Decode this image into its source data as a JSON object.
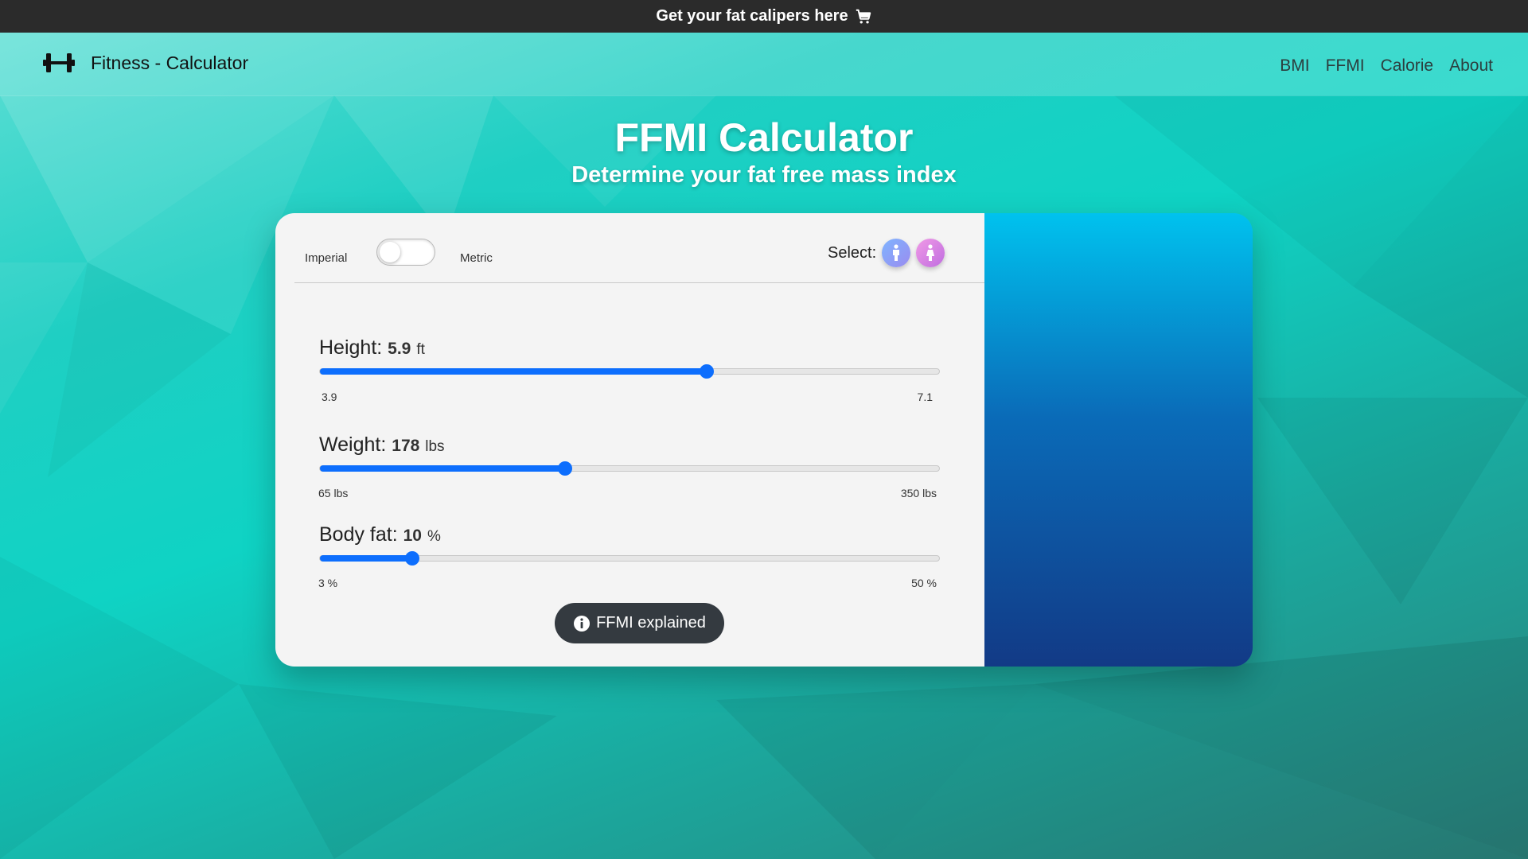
{
  "promo": {
    "text": "Get your fat calipers here",
    "icon": "cart-icon"
  },
  "navbar": {
    "brand": "Fitness - Calculator",
    "brand_icon": "dumbbell-icon",
    "links": [
      "BMI",
      "FFMI",
      "Calorie",
      "About"
    ]
  },
  "hero": {
    "title": "FFMI Calculator",
    "subtitle": "Determine your fat free mass index"
  },
  "calculator": {
    "unit_toggle": {
      "left_label": "Imperial",
      "right_label": "Metric",
      "state": "Imperial"
    },
    "select_label": "Select:",
    "gender_options": [
      "male-icon",
      "female-icon"
    ],
    "height": {
      "label": "Height:",
      "value": "5.9",
      "unit": "ft",
      "min": "3.9",
      "max": "7.1",
      "fraction": 0.625
    },
    "weight": {
      "label": "Weight:",
      "value": "178",
      "unit": "lbs",
      "min": "65 lbs",
      "max": "350 lbs",
      "fraction": 0.396
    },
    "body_fat": {
      "label": "Body fat:",
      "value": "10",
      "unit": "%",
      "min": "3 %",
      "max": "50 %",
      "fraction": 0.149
    },
    "explain_button": "FFMI explained"
  },
  "colors": {
    "accent": "#0d6efd",
    "banner": "#2b2b2b",
    "button": "#343a40",
    "result_gradient_top": "#00c2ee",
    "result_gradient_bottom": "#123a86"
  }
}
